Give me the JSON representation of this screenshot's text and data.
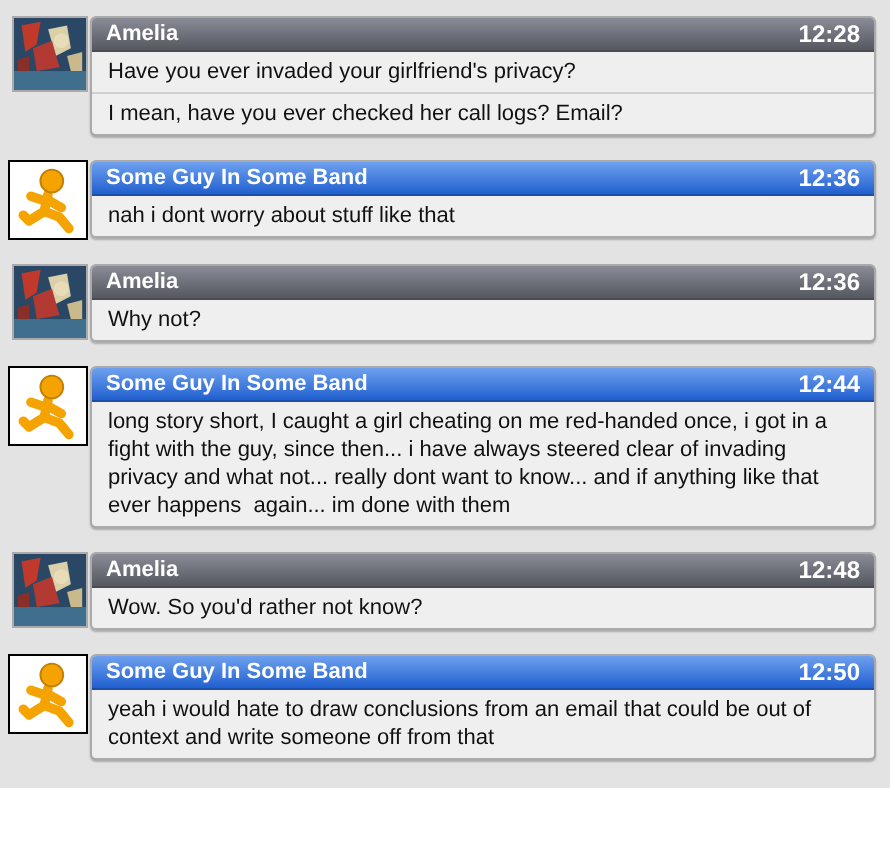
{
  "messages": [
    {
      "kind": "self",
      "sender": "Amelia",
      "time": "12:28",
      "texts": [
        "Have you ever invaded your girlfriend's privacy?",
        "I mean, have you ever checked her call logs? Email?"
      ]
    },
    {
      "kind": "buddy",
      "sender": "Some Guy In Some Band",
      "time": "12:36",
      "texts": [
        "nah i dont worry about stuff like that"
      ]
    },
    {
      "kind": "self",
      "sender": "Amelia",
      "time": "12:36",
      "texts": [
        "Why not?"
      ]
    },
    {
      "kind": "buddy",
      "sender": "Some Guy In Some Band",
      "time": "12:44",
      "texts": [
        "long story short, I caught a girl cheating on me red-handed once, i got in a fight with the guy, since then... i have always steered clear of invading privacy and what not... really dont want to know... and if anything like that ever happens  again... im done with them"
      ]
    },
    {
      "kind": "self",
      "sender": "Amelia",
      "time": "12:48",
      "texts": [
        "Wow. So you'd rather not know?"
      ]
    },
    {
      "kind": "buddy",
      "sender": "Some Guy In Some Band",
      "time": "12:50",
      "texts": [
        "yeah i would hate to draw conclusions from an email that could be out of context and write someone off from that"
      ]
    }
  ]
}
